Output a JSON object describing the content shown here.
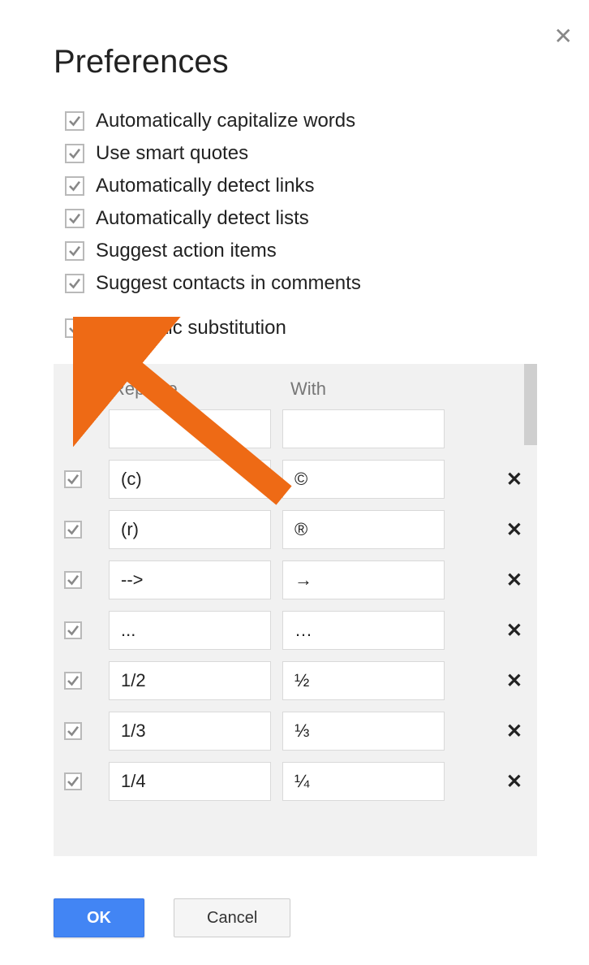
{
  "dialog": {
    "title": "Preferences",
    "options": [
      {
        "label": "Automatically capitalize words",
        "checked": true
      },
      {
        "label": "Use smart quotes",
        "checked": true
      },
      {
        "label": "Automatically detect links",
        "checked": true
      },
      {
        "label": "Automatically detect lists",
        "checked": true
      },
      {
        "label": "Suggest action items",
        "checked": true
      },
      {
        "label": "Suggest contacts in comments",
        "checked": true
      }
    ],
    "auto_substitution": {
      "label": "Automatic substitution",
      "checked": true,
      "headers": {
        "replace": "Replace",
        "with": "With"
      },
      "new_row": {
        "replace": "",
        "with": ""
      },
      "rows": [
        {
          "checked": true,
          "replace": "(c)",
          "with": "©"
        },
        {
          "checked": true,
          "replace": "(r)",
          "with": "®"
        },
        {
          "checked": true,
          "replace": "-->",
          "with": "→"
        },
        {
          "checked": true,
          "replace": "...",
          "with": "…"
        },
        {
          "checked": true,
          "replace": "1/2",
          "with": "½"
        },
        {
          "checked": true,
          "replace": "1/3",
          "with": "⅓"
        },
        {
          "checked": true,
          "replace": "1/4",
          "with": "¼"
        }
      ]
    },
    "buttons": {
      "ok": "OK",
      "cancel": "Cancel"
    }
  }
}
